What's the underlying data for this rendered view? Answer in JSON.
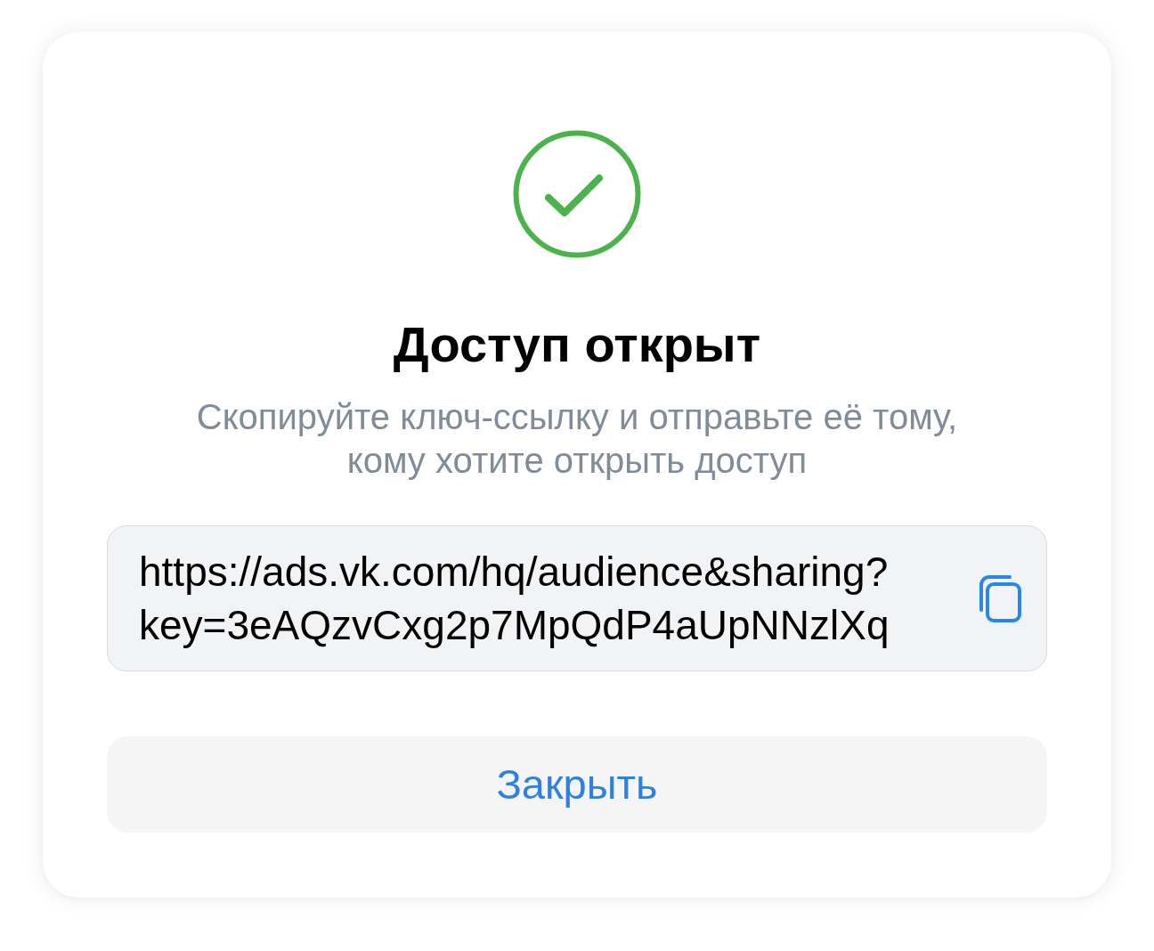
{
  "status_icon": {
    "kind": "success"
  },
  "title": "Доступ открыт",
  "subtitle": "Скопируйте ключ-ссылку и отправьте её тому, кому хотите открыть доступ",
  "link_field": {
    "value": "https://ads.vk.com/hq/audience&sharing?key=3eAQzvCxg2p7MpQdP4aUpNNzlXq"
  },
  "buttons": [
    {
      "label": "Закрыть"
    }
  ]
}
